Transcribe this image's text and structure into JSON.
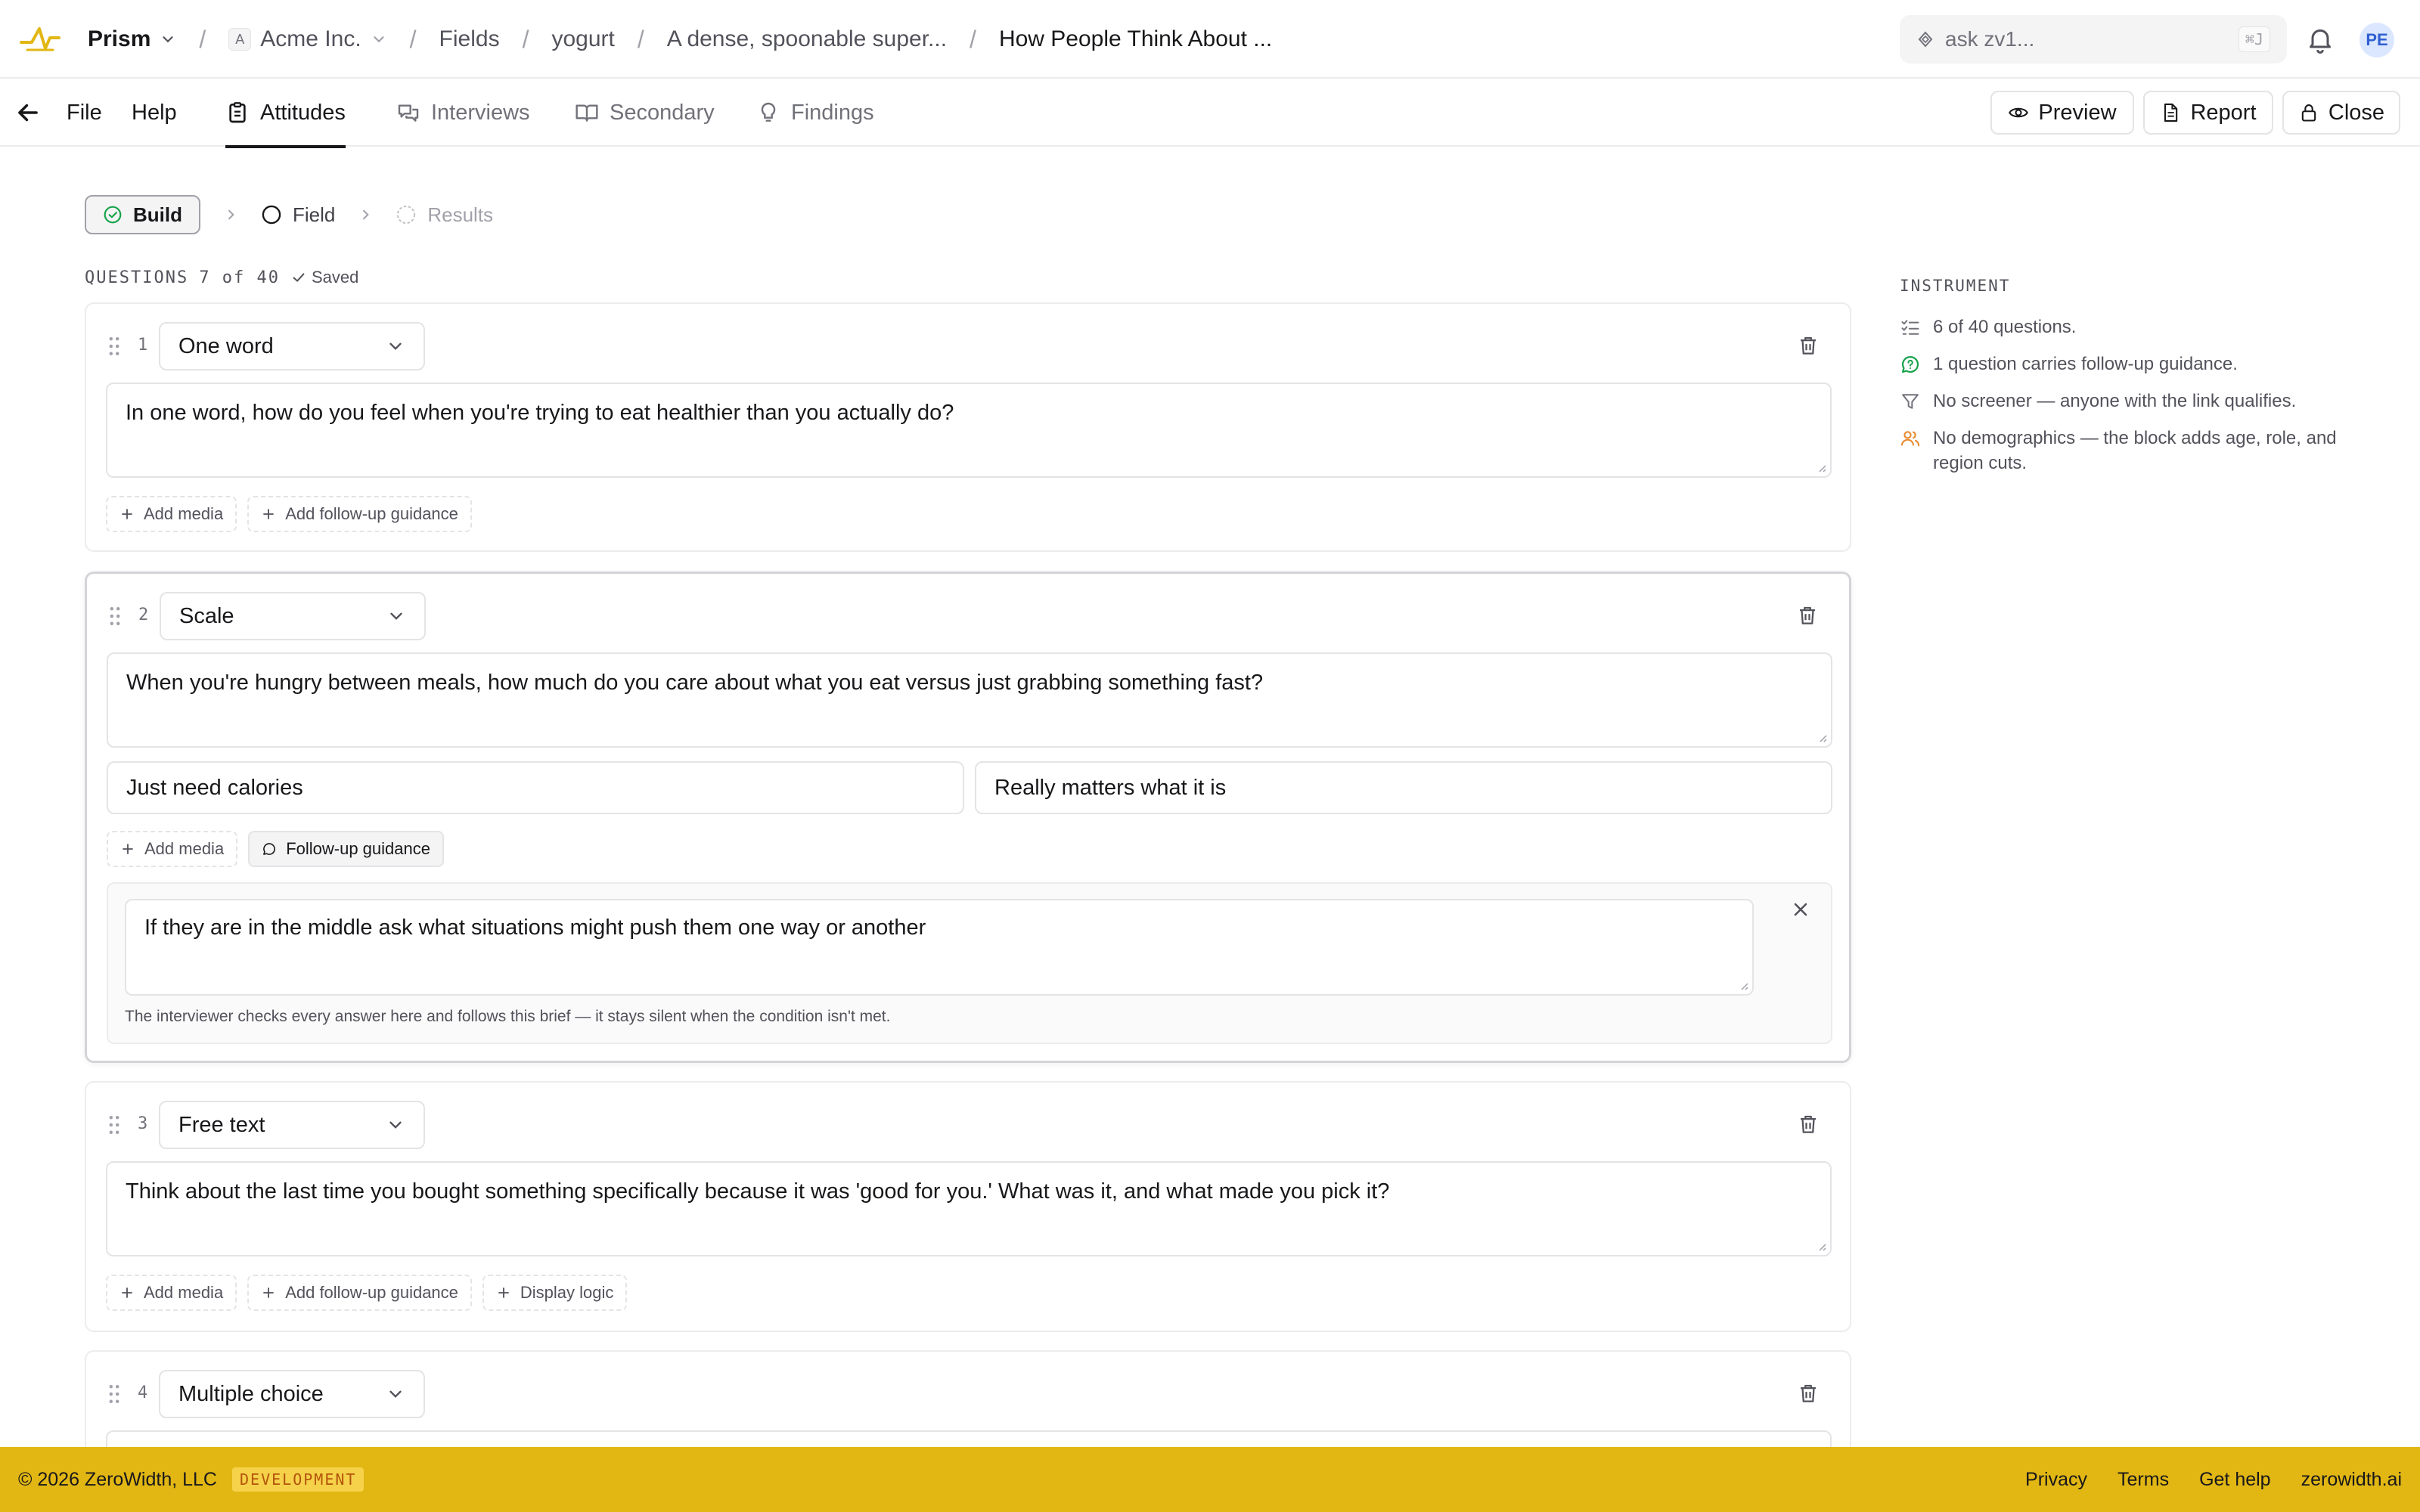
{
  "topbar": {
    "app_name": "Prism",
    "org_initial": "A",
    "org_name": "Acme Inc.",
    "breadcrumbs": [
      "Fields",
      "yogurt",
      "A dense, spoonable super...",
      "How People Think About ..."
    ],
    "ask_placeholder": "ask zv1...",
    "ask_shortcut": "⌘J",
    "user_initials": "PE"
  },
  "nav": {
    "file": "File",
    "help": "Help",
    "tabs": [
      "Attitudes",
      "Interviews",
      "Secondary",
      "Findings"
    ],
    "active_tab": "Attitudes",
    "preview": "Preview",
    "report": "Report",
    "close": "Close"
  },
  "stepper": [
    "Build",
    "Field",
    "Results"
  ],
  "questions_header": {
    "label": "QUESTIONS",
    "count": "7 of 40",
    "status": "Saved"
  },
  "questions": [
    {
      "number": "1",
      "type": "One word",
      "text": "In one word, how do you feel when you're trying to eat healthier than you actually do?",
      "actions": [
        "Add media",
        "Add follow-up guidance"
      ]
    },
    {
      "number": "2",
      "type": "Scale",
      "text": "When you're hungry between meals, how much do you care about what you eat versus just grabbing something fast?",
      "scale_low": "Just need calories",
      "scale_high": "Really matters what it is",
      "actions": [
        "Add media",
        "Follow-up guidance"
      ],
      "guidance": "If they are in the middle ask what situations might push them one way or another",
      "guidance_hint": "The interviewer checks every answer here and follows this brief — it stays silent when the condition isn't met."
    },
    {
      "number": "3",
      "type": "Free text",
      "text": "Think about the last time you bought something specifically because it was 'good for you.' What was it, and what made you pick it?",
      "actions": [
        "Add media",
        "Add follow-up guidance",
        "Display logic"
      ]
    },
    {
      "number": "4",
      "type": "Multiple choice"
    }
  ],
  "instrument": {
    "title": "INSTRUMENT",
    "items": [
      "6 of 40 questions.",
      "1 question carries follow-up guidance.",
      "No screener — anyone with the link qualifies.",
      "No demographics — the block adds age, role, and region cuts."
    ]
  },
  "footer": {
    "copyright": "© 2026 ZeroWidth, LLC",
    "env": "DEVELOPMENT",
    "links": [
      "Privacy",
      "Terms",
      "Get help",
      "zerowidth.ai"
    ]
  },
  "colors": {
    "accent_yellow": "#e2b714",
    "guidance_green": "#16a34a",
    "demographics_orange": "#ea8a2f",
    "avatar_blue": "#dbe7ff"
  }
}
